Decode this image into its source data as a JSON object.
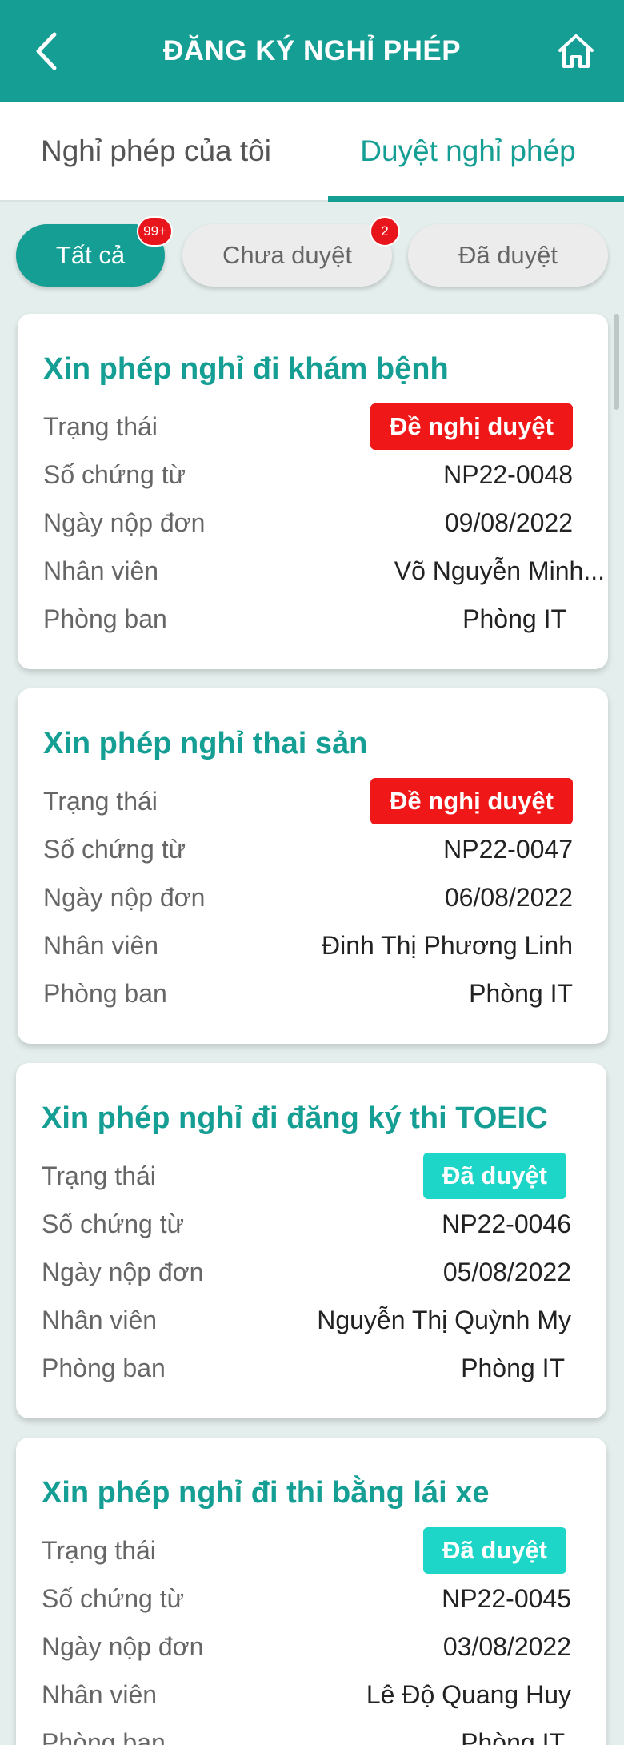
{
  "header": {
    "title": "ĐĂNG KÝ NGHỈ PHÉP",
    "back_icon": "chevron-left-icon",
    "home_icon": "home-icon"
  },
  "tabs": [
    {
      "label": "Nghỉ phép của tôi",
      "active": false
    },
    {
      "label": "Duyệt nghỉ phép",
      "active": true
    }
  ],
  "filters": [
    {
      "label": "Tất cả",
      "badge": "99+",
      "active": true
    },
    {
      "label": "Chưa duyệt",
      "badge": "2",
      "active": false
    },
    {
      "label": "Đã duyệt",
      "badge": "",
      "active": false
    }
  ],
  "field_labels": {
    "status": "Trạng thái",
    "doc_no": "Số chứng từ",
    "date": "Ngày nộp đơn",
    "employee": "Nhân viên",
    "department": "Phòng ban"
  },
  "requests": [
    {
      "title": "Xin phép nghỉ đi khám bệnh",
      "status": "Đề nghị duyệt",
      "doc_no": "NP22-0048",
      "date": "09/08/2022",
      "employee": "Võ Nguyễn Minh...",
      "department": "Phòng IT"
    },
    {
      "title": "Xin phép nghỉ thai sản",
      "status": "Đề nghị duyệt",
      "doc_no": "NP22-0047",
      "date": "06/08/2022",
      "employee": "Đinh Thị Phương Linh",
      "department": "Phòng IT"
    },
    {
      "title": "Xin phép nghỉ đi đăng ký thi TOEIC",
      "status": "Đã duyệt",
      "doc_no": "NP22-0046",
      "date": "05/08/2022",
      "employee": "Nguyễn Thị Quỳnh My",
      "department": "Phòng IT"
    },
    {
      "title": "Xin phép nghỉ đi thi bằng lái xe",
      "status": "Đã duyệt",
      "doc_no": "NP22-0045",
      "date": "03/08/2022",
      "employee": "Lê Độ Quang Huy",
      "department": "Phòng IT"
    }
  ],
  "colors": {
    "primary": "#159e93",
    "pending": "#ef1717",
    "approved": "#1ed6c8",
    "badge": "#e8161c"
  }
}
